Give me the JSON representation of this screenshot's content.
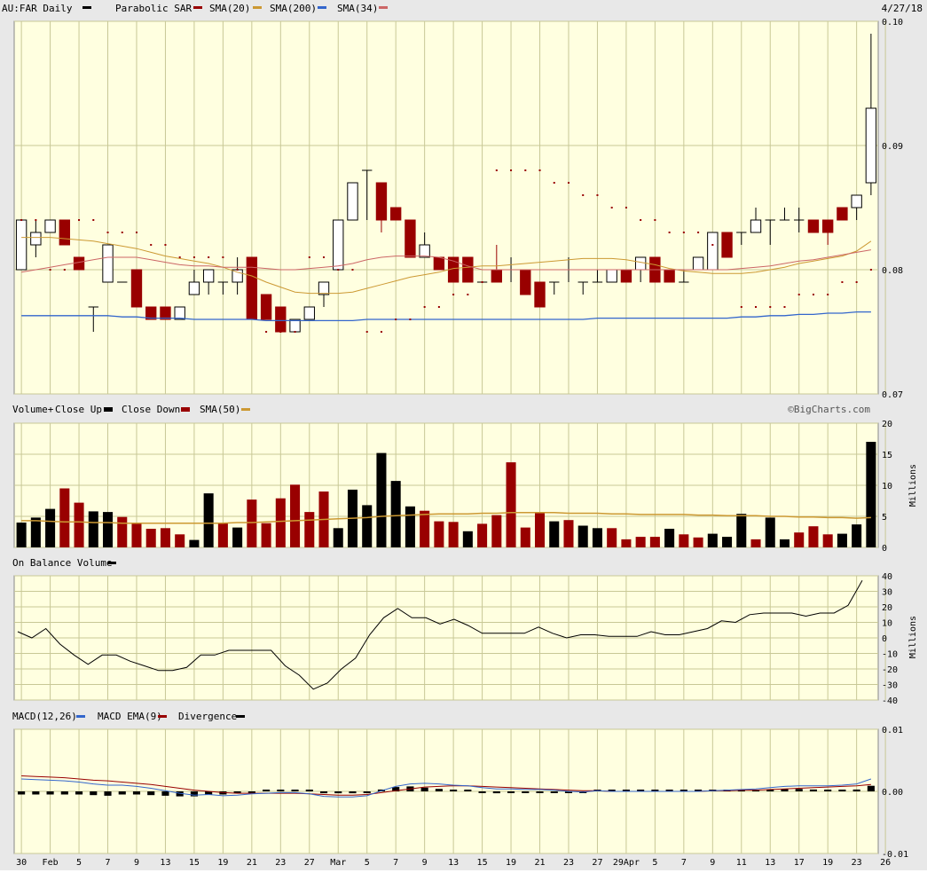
{
  "colors": {
    "background": "#e8e8e8",
    "plot_bg": "#ffffe0",
    "grid": "#c8c896",
    "up": "#000000",
    "down": "#990000",
    "sma20": "#990000",
    "sma200": "#cc9933",
    "sma34": "#3366cc",
    "sar": "#990000",
    "macd": "#3366cc",
    "macd_ema": "#990000",
    "volume_sma": "#cc9933"
  },
  "header": {
    "symbol_label": "AU:FAR Daily",
    "sar_label": "Parabolic SAR",
    "sma20_label": "SMA(20)",
    "sma200_label": "SMA(200)",
    "sma34_label": "SMA(34)",
    "date": "4/27/18"
  },
  "volume_header": {
    "label": "Volume+",
    "close_up": "Close Up",
    "close_down": "Close Down",
    "sma_label": "SMA(50)",
    "credit": "©BigCharts.com",
    "unit": "Millions"
  },
  "obv_header": {
    "label": "On Balance Volume",
    "unit": "Millions"
  },
  "macd_header": {
    "label": "MACD(12,26)",
    "ema_label": "MACD EMA(9)",
    "div_label": "Divergence"
  },
  "x_axis": {
    "tick_labels": [
      "30",
      "Feb",
      "5",
      "7",
      "9",
      "13",
      "15",
      "19",
      "21",
      "23",
      "27",
      "Mar",
      "5",
      "7",
      "9",
      "13",
      "15",
      "19",
      "21",
      "23",
      "27",
      "29Apr",
      "5",
      "7",
      "9",
      "11",
      "13",
      "17",
      "19",
      "23",
      "26"
    ],
    "tick_bars": [
      0,
      2,
      4,
      6,
      8,
      10,
      12,
      14,
      16,
      18,
      20,
      22,
      24,
      26,
      28,
      30,
      32,
      34,
      36,
      38,
      40,
      42,
      44,
      46,
      48,
      50,
      52,
      54,
      56,
      58,
      60
    ]
  },
  "chart_data": [
    {
      "type": "candlestick",
      "name": "price",
      "ylim": [
        0.07,
        0.1
      ],
      "y_ticks": [
        "0.10",
        "0.09",
        "0.08",
        "0.07"
      ],
      "y_tick_values": [
        0.1,
        0.09,
        0.08,
        0.07
      ],
      "candles": [
        [
          0.08,
          0.084,
          0.084,
          0.08
        ],
        [
          0.082,
          0.083,
          0.084,
          0.081
        ],
        [
          0.083,
          0.084,
          0.084,
          0.083
        ],
        [
          0.084,
          0.082,
          0.084,
          0.082
        ],
        [
          0.081,
          0.08,
          0.081,
          0.08
        ],
        [
          0.077,
          0.077,
          0.077,
          0.075
        ],
        [
          0.079,
          0.082,
          0.082,
          0.079
        ],
        [
          0.079,
          0.079,
          0.079,
          0.079
        ],
        [
          0.08,
          0.077,
          0.08,
          0.077
        ],
        [
          0.077,
          0.076,
          0.077,
          0.076
        ],
        [
          0.077,
          0.076,
          0.077,
          0.076
        ],
        [
          0.076,
          0.077,
          0.077,
          0.076
        ],
        [
          0.078,
          0.079,
          0.08,
          0.078
        ],
        [
          0.079,
          0.08,
          0.08,
          0.078
        ],
        [
          0.079,
          0.079,
          0.079,
          0.078
        ],
        [
          0.079,
          0.08,
          0.081,
          0.078
        ],
        [
          0.081,
          0.076,
          0.081,
          0.076
        ],
        [
          0.078,
          0.076,
          0.078,
          0.076
        ],
        [
          0.077,
          0.075,
          0.077,
          0.075
        ],
        [
          0.075,
          0.076,
          0.076,
          0.075
        ],
        [
          0.076,
          0.077,
          0.077,
          0.076
        ],
        [
          0.078,
          0.079,
          0.079,
          0.077
        ],
        [
          0.08,
          0.084,
          0.084,
          0.08
        ],
        [
          0.084,
          0.087,
          0.087,
          0.084
        ],
        [
          0.088,
          0.088,
          0.088,
          0.084
        ],
        [
          0.087,
          0.084,
          0.087,
          0.083
        ],
        [
          0.085,
          0.084,
          0.085,
          0.084
        ],
        [
          0.084,
          0.081,
          0.084,
          0.081
        ],
        [
          0.081,
          0.082,
          0.083,
          0.081
        ],
        [
          0.081,
          0.08,
          0.081,
          0.08
        ],
        [
          0.081,
          0.079,
          0.081,
          0.079
        ],
        [
          0.081,
          0.079,
          0.081,
          0.079
        ],
        [
          0.079,
          0.079,
          0.079,
          0.079
        ],
        [
          0.08,
          0.079,
          0.082,
          0.079
        ],
        [
          0.08,
          0.08,
          0.081,
          0.079
        ],
        [
          0.08,
          0.078,
          0.08,
          0.078
        ],
        [
          0.079,
          0.077,
          0.079,
          0.077
        ],
        [
          0.079,
          0.079,
          0.079,
          0.078
        ],
        [
          0.08,
          0.08,
          0.081,
          0.079
        ],
        [
          0.079,
          0.079,
          0.079,
          0.078
        ],
        [
          0.079,
          0.079,
          0.08,
          0.079
        ],
        [
          0.079,
          0.08,
          0.08,
          0.079
        ],
        [
          0.08,
          0.079,
          0.08,
          0.079
        ],
        [
          0.08,
          0.081,
          0.081,
          0.079
        ],
        [
          0.081,
          0.079,
          0.081,
          0.079
        ],
        [
          0.08,
          0.079,
          0.08,
          0.079
        ],
        [
          0.079,
          0.079,
          0.08,
          0.079
        ],
        [
          0.08,
          0.081,
          0.081,
          0.08
        ],
        [
          0.08,
          0.083,
          0.083,
          0.08
        ],
        [
          0.083,
          0.081,
          0.083,
          0.081
        ],
        [
          0.083,
          0.083,
          0.083,
          0.082
        ],
        [
          0.083,
          0.084,
          0.085,
          0.083
        ],
        [
          0.084,
          0.084,
          0.084,
          0.082
        ],
        [
          0.084,
          0.084,
          0.085,
          0.084
        ],
        [
          0.084,
          0.084,
          0.085,
          0.083
        ],
        [
          0.084,
          0.083,
          0.084,
          0.083
        ],
        [
          0.084,
          0.083,
          0.084,
          0.082
        ],
        [
          0.085,
          0.084,
          0.085,
          0.084
        ],
        [
          0.085,
          0.086,
          0.086,
          0.084
        ],
        [
          0.087,
          0.093,
          0.099,
          0.086
        ]
      ],
      "sar": [
        0.084,
        0.084,
        0.08,
        0.08,
        0.084,
        0.084,
        0.083,
        0.083,
        0.083,
        0.082,
        0.082,
        0.081,
        0.081,
        0.081,
        0.081,
        0.08,
        0.08,
        0.075,
        0.075,
        0.075,
        0.081,
        0.081,
        0.08,
        0.08,
        0.075,
        0.075,
        0.076,
        0.076,
        0.077,
        0.077,
        0.078,
        0.078,
        0.079,
        0.088,
        0.088,
        0.088,
        0.088,
        0.087,
        0.087,
        0.086,
        0.086,
        0.085,
        0.085,
        0.084,
        0.084,
        0.083,
        0.083,
        0.083,
        0.082,
        0.082,
        0.077,
        0.077,
        0.077,
        0.077,
        0.078,
        0.078,
        0.078,
        0.079,
        0.079,
        0.08
      ],
      "sma20": [
        0.0798,
        0.08,
        0.0802,
        0.0804,
        0.0806,
        0.0808,
        0.081,
        0.081,
        0.081,
        0.0808,
        0.0806,
        0.0804,
        0.0803,
        0.0803,
        0.0802,
        0.0802,
        0.0802,
        0.0801,
        0.08,
        0.08,
        0.0801,
        0.0802,
        0.0803,
        0.0805,
        0.0808,
        0.081,
        0.0811,
        0.0811,
        0.0811,
        0.081,
        0.0807,
        0.0803,
        0.08,
        0.08,
        0.08,
        0.08,
        0.08,
        0.08,
        0.08,
        0.08,
        0.08,
        0.08,
        0.08,
        0.08,
        0.08,
        0.08,
        0.08,
        0.08,
        0.08,
        0.08,
        0.0801,
        0.0802,
        0.0803,
        0.0805,
        0.0807,
        0.0808,
        0.081,
        0.0812,
        0.0814,
        0.0816
      ],
      "sma200": [
        0.0826,
        0.0826,
        0.0826,
        0.0825,
        0.0824,
        0.0823,
        0.0821,
        0.0819,
        0.0817,
        0.0814,
        0.0811,
        0.0809,
        0.0807,
        0.0805,
        0.0802,
        0.0798,
        0.0795,
        0.079,
        0.0786,
        0.0782,
        0.0781,
        0.0781,
        0.0781,
        0.0782,
        0.0785,
        0.0788,
        0.0791,
        0.0794,
        0.0796,
        0.0798,
        0.0801,
        0.0802,
        0.0803,
        0.0803,
        0.0804,
        0.0805,
        0.0806,
        0.0807,
        0.0808,
        0.0809,
        0.0809,
        0.0809,
        0.0808,
        0.0806,
        0.0804,
        0.0801,
        0.0799,
        0.0798,
        0.0797,
        0.0797,
        0.0797,
        0.0798,
        0.08,
        0.0802,
        0.0805,
        0.0807,
        0.0809,
        0.0811,
        0.0815,
        0.0823
      ],
      "sma34": [
        0.0763,
        0.0763,
        0.0763,
        0.0763,
        0.0763,
        0.0763,
        0.0763,
        0.0762,
        0.0762,
        0.0761,
        0.0761,
        0.0761,
        0.076,
        0.076,
        0.076,
        0.076,
        0.076,
        0.0759,
        0.0759,
        0.0759,
        0.0759,
        0.0759,
        0.0759,
        0.0759,
        0.076,
        0.076,
        0.076,
        0.076,
        0.076,
        0.076,
        0.076,
        0.076,
        0.076,
        0.076,
        0.076,
        0.076,
        0.076,
        0.076,
        0.076,
        0.076,
        0.0761,
        0.0761,
        0.0761,
        0.0761,
        0.0761,
        0.0761,
        0.0761,
        0.0761,
        0.0761,
        0.0761,
        0.0762,
        0.0762,
        0.0763,
        0.0763,
        0.0764,
        0.0764,
        0.0765,
        0.0765,
        0.0766,
        0.0766
      ]
    },
    {
      "type": "bar",
      "name": "volume",
      "ylim": [
        0,
        20
      ],
      "y_ticks": [
        "20",
        "15",
        "10",
        "5",
        "0"
      ],
      "y_tick_values": [
        20,
        15,
        10,
        5,
        0
      ],
      "values": [
        4,
        4.8,
        6.2,
        9.5,
        7.2,
        5.8,
        5.7,
        4.9,
        3.9,
        3.0,
        3.1,
        2.1,
        1.2,
        8.7,
        3.9,
        3.2,
        7.7,
        3.9,
        7.9,
        10.1,
        5.7,
        9.0,
        3.1,
        9.3,
        6.8,
        15.2,
        10.7,
        6.6,
        5.9,
        4.2,
        4.1,
        2.6,
        3.8,
        5.2,
        13.7,
        3.2,
        5.6,
        4.2,
        4.4,
        3.5,
        3.1,
        3.1,
        1.3,
        1.7,
        1.7,
        3.0,
        2.1,
        1.6,
        2.2,
        1.7,
        5.4,
        1.3,
        4.8,
        1.3,
        2.4,
        3.4,
        2.1,
        2.2,
        3.7,
        17
      ],
      "up": [
        1,
        1,
        1,
        0,
        0,
        1,
        1,
        0,
        0,
        0,
        0,
        0,
        1,
        1,
        0,
        1,
        0,
        0,
        0,
        0,
        0,
        0,
        1,
        1,
        1,
        1,
        1,
        1,
        0,
        0,
        0,
        1,
        0,
        0,
        0,
        0,
        0,
        1,
        0,
        1,
        1,
        0,
        0,
        0,
        0,
        1,
        0,
        0,
        1,
        1,
        1,
        0,
        1,
        1,
        0,
        0,
        0,
        1,
        1,
        1
      ],
      "sma50": [
        4.3,
        4.3,
        4.2,
        4.1,
        4.1,
        4.0,
        4.0,
        3.9,
        3.9,
        3.9,
        3.9,
        3.9,
        3.9,
        3.9,
        3.9,
        4.0,
        4.0,
        4.1,
        4.2,
        4.3,
        4.4,
        4.5,
        4.6,
        4.7,
        4.8,
        5.0,
        5.1,
        5.2,
        5.3,
        5.4,
        5.4,
        5.4,
        5.5,
        5.5,
        5.6,
        5.6,
        5.6,
        5.6,
        5.5,
        5.5,
        5.5,
        5.4,
        5.4,
        5.3,
        5.3,
        5.3,
        5.3,
        5.2,
        5.2,
        5.1,
        5.1,
        5.1,
        5.0,
        5.0,
        4.9,
        4.9,
        4.8,
        4.8,
        4.7,
        4.8
      ]
    },
    {
      "type": "line",
      "name": "on_balance_volume",
      "ylim": [
        -40,
        40
      ],
      "y_ticks": [
        "40",
        "30",
        "20",
        "10",
        "0",
        "-10",
        "-20",
        "-30",
        "-40"
      ],
      "y_tick_values": [
        40,
        30,
        20,
        10,
        0,
        -10,
        -20,
        -30,
        -40
      ],
      "values": [
        4,
        0,
        6,
        -4,
        -11,
        -17,
        -11,
        -11,
        -15,
        -18,
        -21,
        -21,
        -19,
        -11,
        -11,
        -8,
        -8,
        -8,
        -8,
        -18,
        -24,
        -33,
        -29,
        -20,
        -13,
        2,
        13,
        19,
        13,
        13,
        9,
        12,
        8,
        3,
        3,
        3,
        3,
        7,
        3,
        0,
        2,
        2,
        1,
        1,
        1,
        4,
        2,
        2,
        4,
        6,
        11,
        10,
        15,
        16,
        16,
        16,
        14,
        16,
        16,
        21,
        37
      ]
    },
    {
      "type": "line",
      "name": "macd",
      "ylim": [
        -0.01,
        0.01
      ],
      "y_ticks": [
        "0.01",
        "0.00",
        "-0.01"
      ],
      "y_tick_values": [
        0.01,
        0.0,
        -0.01
      ],
      "macd": [
        0.002,
        0.0019,
        0.0018,
        0.0017,
        0.0015,
        0.0012,
        0.001,
        0.001,
        0.0008,
        0.0005,
        0.0001,
        -0.0003,
        -0.0006,
        -0.0005,
        -0.0007,
        -0.0006,
        -0.0004,
        -0.0003,
        -0.0002,
        -0.0002,
        -0.0004,
        -0.0008,
        -0.0009,
        -0.0009,
        -0.0007,
        0.0001,
        0.0008,
        0.0012,
        0.0013,
        0.0012,
        0.001,
        0.0009,
        0.0006,
        0.0004,
        0.0004,
        0.0003,
        0.0003,
        0.0002,
        0.0,
        -0.0001,
        0.0001,
        0.0,
        0.0,
        0.0,
        0.0,
        0.0,
        0.0,
        0.0,
        0.0001,
        0.0002,
        0.0003,
        0.0004,
        0.0006,
        0.0008,
        0.0009,
        0.0009,
        0.0009,
        0.001,
        0.0012,
        0.002
      ],
      "ema": [
        0.0025,
        0.0024,
        0.0023,
        0.0022,
        0.002,
        0.0018,
        0.0017,
        0.0015,
        0.0013,
        0.0011,
        0.0008,
        0.0005,
        0.0002,
        0.0,
        -0.0002,
        -0.0003,
        -0.0003,
        -0.0003,
        -0.0003,
        -0.0003,
        -0.0004,
        -0.0005,
        -0.0006,
        -0.0006,
        -0.0005,
        -0.0002,
        0.0001,
        0.0004,
        0.0007,
        0.0008,
        0.0009,
        0.0009,
        0.0008,
        0.0007,
        0.0006,
        0.0005,
        0.0004,
        0.0003,
        0.0002,
        0.0001,
        0.0001,
        0.0,
        0.0,
        0.0,
        0.0,
        0.0,
        0.0,
        0.0,
        0.0001,
        0.0001,
        0.0002,
        0.0002,
        0.0003,
        0.0004,
        0.0005,
        0.0006,
        0.0007,
        0.0008,
        0.0009,
        0.0011
      ],
      "divergence": [
        -0.0005,
        -0.0005,
        -0.0005,
        -0.0005,
        -0.0005,
        -0.0006,
        -0.0007,
        -0.0005,
        -0.0005,
        -0.0006,
        -0.0007,
        -0.0008,
        -0.0008,
        -0.0005,
        -0.0005,
        -0.0003,
        -0.0001,
        0.0,
        0.0001,
        0.0001,
        0.0,
        -0.0003,
        -0.0003,
        -0.0003,
        -0.0002,
        0.0003,
        0.0007,
        0.0008,
        0.0006,
        0.0004,
        0.0001,
        0.0,
        -0.0002,
        -0.0003,
        -0.0002,
        -0.0002,
        -0.0001,
        -0.0001,
        -0.0002,
        -0.0002,
        0.0,
        0.0,
        0.0,
        0.0,
        0.0,
        0.0,
        0.0,
        0.0,
        0.0,
        0.0001,
        0.0001,
        0.0002,
        0.0003,
        0.0004,
        0.0004,
        0.0003,
        0.0002,
        0.0002,
        0.0003,
        0.0009
      ]
    }
  ]
}
